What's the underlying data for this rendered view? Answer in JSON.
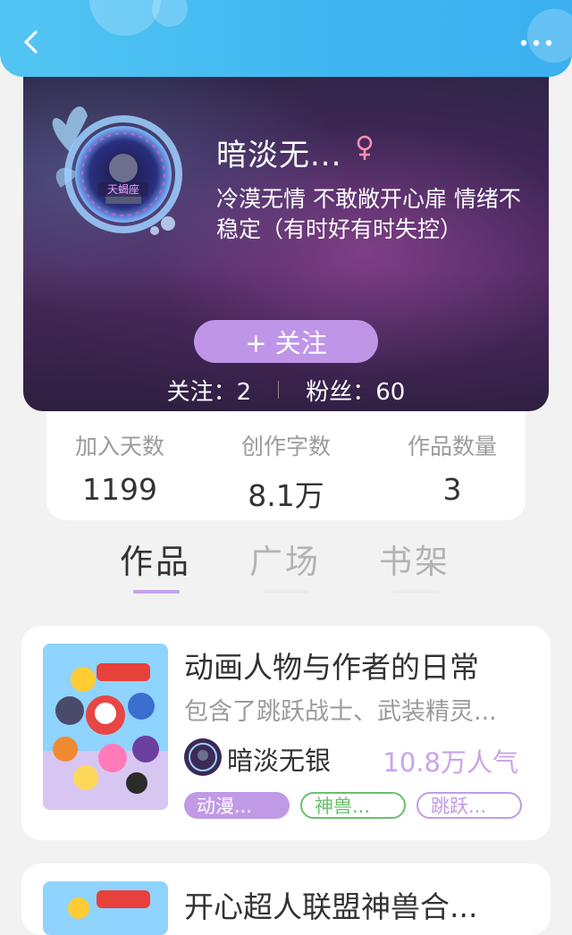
{
  "header": {
    "username": "暗淡无...",
    "bio": "冷漠无情 不敢敞开心扉 情绪不稳定（有时好有时失控）",
    "avatar_badge": "天蝎座",
    "follow_label": "+  关注",
    "following_label": "关注：2",
    "fans_label": "粉丝：60"
  },
  "info": {
    "items": [
      {
        "label": "加入天数",
        "value": "1199"
      },
      {
        "label": "创作字数",
        "value": "8.1万"
      },
      {
        "label": "作品数量",
        "value": "3"
      }
    ]
  },
  "tabs": [
    {
      "label": "作品",
      "active": true
    },
    {
      "label": "广场",
      "active": false
    },
    {
      "label": "书架",
      "active": false
    }
  ],
  "works": [
    {
      "title": "动画人物与作者的日常",
      "description": "包含了跳跃战士、武装精灵...",
      "author": "暗淡无银",
      "popularity": "10.8万人气",
      "tags": [
        "动漫...",
        "神兽...",
        "跳跃..."
      ]
    },
    {
      "title": "开心超人联盟神兽合..."
    }
  ],
  "colors": {
    "topbar": "#3fb6f1",
    "accent": "#bf95e8",
    "tag_green": "#6bbf6b",
    "tag_purple": "#c09ae6"
  }
}
